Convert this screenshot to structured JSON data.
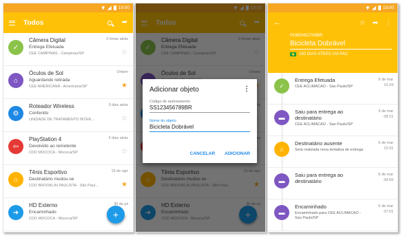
{
  "status_bar": {
    "time": "19:00"
  },
  "list_screen": {
    "title": "Todos",
    "items": [
      {
        "name": "Câmera Digital",
        "status": "Entrega Efetuada",
        "location": "CEE CAMPINAS - Campinas/SP",
        "time": "3 horas atrás",
        "starred": false,
        "color": "#8bc34a",
        "icon": "delivered-icon"
      },
      {
        "name": "Óculos de Sol",
        "status": "Aguardando retirada",
        "location": "CEE AMERICANA - Americana/SP",
        "time": "Ontem",
        "starred": true,
        "color": "#7e57c2",
        "icon": "waiting-pickup-icon"
      },
      {
        "name": "Roteador Wireless",
        "status": "Conferido",
        "location": "UNIDADE DE TRATAMENTO INTER...",
        "time": "3 dias atrás",
        "starred": false,
        "color": "#1e88e5",
        "icon": "checked-icon"
      },
      {
        "name": "PlayStation 4",
        "status": "Devolvido ao remetente",
        "location": "CDD MOCOCA - Mococa/SP",
        "time": "5 dias atrás",
        "starred": false,
        "color": "#e53935",
        "icon": "returned-icon"
      },
      {
        "name": "Tênis Esportivo",
        "status": "Destinatário mudou-se",
        "location": "CDD BROOKLIN PAULISTA - São Paul...",
        "time": "15 de ago",
        "starred": true,
        "color": "#ffb300",
        "icon": "moved-icon"
      },
      {
        "name": "HD Externo",
        "status": "Encaminhado",
        "location": "CDD MOCOCA - Mococa/SP",
        "time": "30 de jul",
        "starred": false,
        "color": "#1e9be8",
        "icon": "forwarded-icon"
      }
    ]
  },
  "dialog": {
    "title": "Adicionar objeto",
    "tracking_label": "Código de rastreamento",
    "tracking_value": "SS123456789BR",
    "name_label": "Nome do objeto",
    "name_value": "Bicicleta Dobrável",
    "cancel": "CANCELAR",
    "add": "ADICIONAR"
  },
  "detail_screen": {
    "code": "PO850452708BR",
    "name": "Bicicleta Dobrável",
    "subtitle": "160 DIAS ATRÁS VIA PAC",
    "events": [
      {
        "title": "Entrega Efetuada",
        "desc": "CEE ACLIMACAO - Sao Paulo/SP",
        "date": "9 de mar",
        "time": "10:24",
        "color": "#8bc34a",
        "icon": "delivered-icon"
      },
      {
        "title": "Saiu para entrega ao destinatário",
        "desc": "CEE ACLIMACAO - Sao Paulo/SP",
        "date": "9 de mar",
        "time": "08:21",
        "color": "#7e57c2",
        "icon": "truck-icon"
      },
      {
        "title": "Destinatário ausente",
        "desc": "Será realizada nova tentativa de entrega",
        "date": "6 de mar",
        "time": "12:31",
        "color": "#ffb300",
        "icon": "home-icon"
      },
      {
        "title": "Saiu para entrega ao destinatário",
        "desc": "",
        "date": "6 de mar",
        "time": "09:59",
        "color": "#7e57c2",
        "icon": "truck-icon"
      },
      {
        "title": "Encaminhado",
        "desc": "Encaminhado para CEE ACLIMACAO - Sao Paulo/SP",
        "date": "6 de mar",
        "time": "07:01",
        "color": "#7e57c2",
        "icon": "truck-icon"
      }
    ]
  }
}
